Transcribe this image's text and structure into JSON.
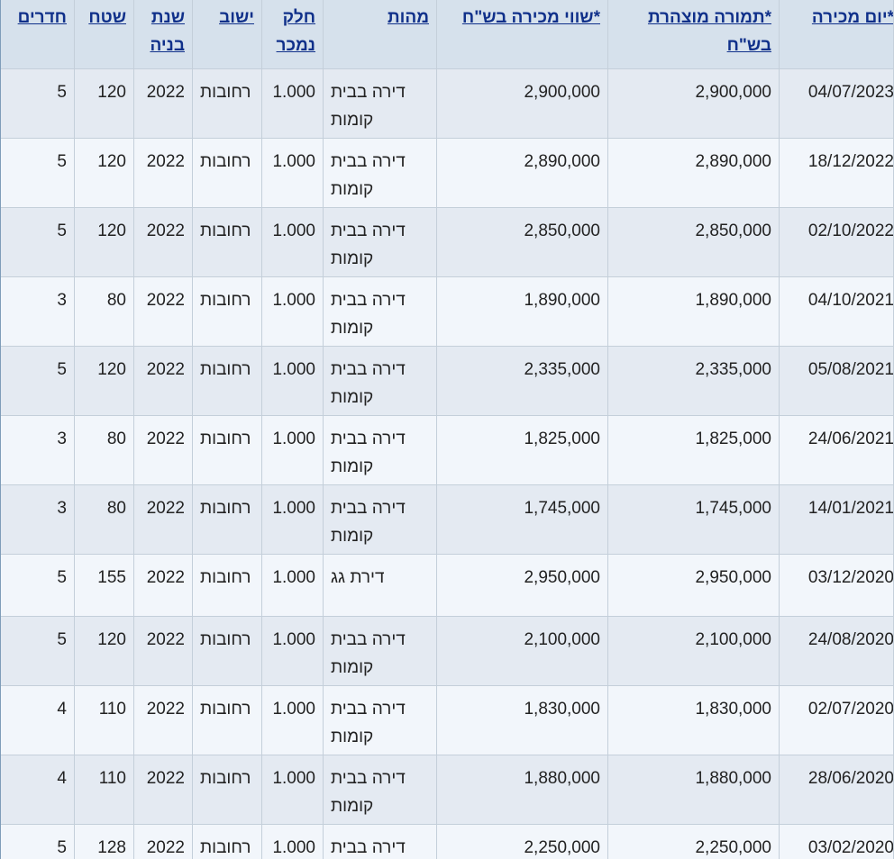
{
  "headers": {
    "date": "*יום מכירה",
    "declared": "*תמורה מוצהרת בש\"ח",
    "value": "*שווי מכירה בש\"ח",
    "type": "מהות",
    "part": "חלק נמכר",
    "city": "ישוב",
    "year": "שנת בניה",
    "area": "שטח",
    "rooms": "חדרים"
  },
  "rows": [
    {
      "date": "04/07/2023",
      "declared": "2,900,000",
      "value": "2,900,000",
      "type": "דירה בבית קומות",
      "part": "1.000",
      "city": "רחובות",
      "year": "2022",
      "area": "120",
      "rooms": "5"
    },
    {
      "date": "18/12/2022",
      "declared": "2,890,000",
      "value": "2,890,000",
      "type": "דירה בבית קומות",
      "part": "1.000",
      "city": "רחובות",
      "year": "2022",
      "area": "120",
      "rooms": "5"
    },
    {
      "date": "02/10/2022",
      "declared": "2,850,000",
      "value": "2,850,000",
      "type": "דירה בבית קומות",
      "part": "1.000",
      "city": "רחובות",
      "year": "2022",
      "area": "120",
      "rooms": "5"
    },
    {
      "date": "04/10/2021",
      "declared": "1,890,000",
      "value": "1,890,000",
      "type": "דירה בבית קומות",
      "part": "1.000",
      "city": "רחובות",
      "year": "2022",
      "area": "80",
      "rooms": "3"
    },
    {
      "date": "05/08/2021",
      "declared": "2,335,000",
      "value": "2,335,000",
      "type": "דירה בבית קומות",
      "part": "1.000",
      "city": "רחובות",
      "year": "2022",
      "area": "120",
      "rooms": "5"
    },
    {
      "date": "24/06/2021",
      "declared": "1,825,000",
      "value": "1,825,000",
      "type": "דירה בבית קומות",
      "part": "1.000",
      "city": "רחובות",
      "year": "2022",
      "area": "80",
      "rooms": "3"
    },
    {
      "date": "14/01/2021",
      "declared": "1,745,000",
      "value": "1,745,000",
      "type": "דירה בבית קומות",
      "part": "1.000",
      "city": "רחובות",
      "year": "2022",
      "area": "80",
      "rooms": "3"
    },
    {
      "date": "03/12/2020",
      "declared": "2,950,000",
      "value": "2,950,000",
      "type": "דירת גג",
      "part": "1.000",
      "city": "רחובות",
      "year": "2022",
      "area": "155",
      "rooms": "5"
    },
    {
      "date": "24/08/2020",
      "declared": "2,100,000",
      "value": "2,100,000",
      "type": "דירה בבית קומות",
      "part": "1.000",
      "city": "רחובות",
      "year": "2022",
      "area": "120",
      "rooms": "5"
    },
    {
      "date": "02/07/2020",
      "declared": "1,830,000",
      "value": "1,830,000",
      "type": "דירה בבית קומות",
      "part": "1.000",
      "city": "רחובות",
      "year": "2022",
      "area": "110",
      "rooms": "4"
    },
    {
      "date": "28/06/2020",
      "declared": "1,880,000",
      "value": "1,880,000",
      "type": "דירה בבית קומות",
      "part": "1.000",
      "city": "רחובות",
      "year": "2022",
      "area": "110",
      "rooms": "4"
    },
    {
      "date": "03/02/2020",
      "declared": "2,250,000",
      "value": "2,250,000",
      "type": "דירה בבית קומות",
      "part": "1.000",
      "city": "רחובות",
      "year": "2022",
      "area": "128",
      "rooms": "5"
    }
  ]
}
